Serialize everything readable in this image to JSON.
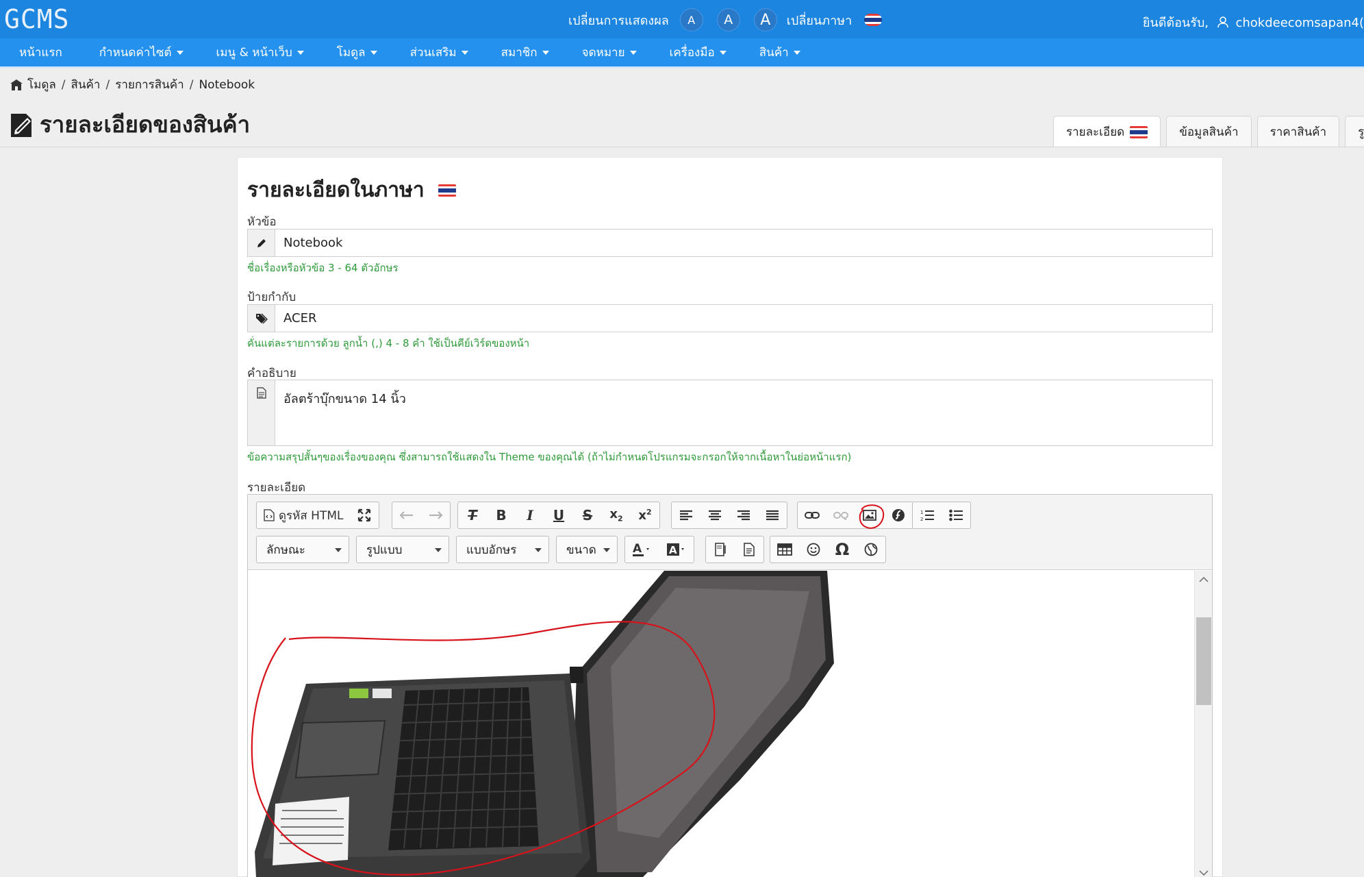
{
  "app": {
    "logo": "GCMS"
  },
  "topbar": {
    "display_label": "เปลี่ยนการแสดงผล",
    "font_sizes": [
      "A",
      "A",
      "A"
    ],
    "language_label": "เปลี่ยนภาษา",
    "welcome": "ยินดีต้อนรับ,",
    "username": "chokdeecomsapan4("
  },
  "nav": {
    "items": [
      {
        "label": "หน้าแรก",
        "dropdown": false
      },
      {
        "label": "กำหนดค่าไซต์",
        "dropdown": true
      },
      {
        "label": "เมนู & หน้าเว็บ",
        "dropdown": true
      },
      {
        "label": "โมดูล",
        "dropdown": true
      },
      {
        "label": "ส่วนเสริม",
        "dropdown": true
      },
      {
        "label": "สมาชิก",
        "dropdown": true
      },
      {
        "label": "จดหมาย",
        "dropdown": true
      },
      {
        "label": "เครื่องมือ",
        "dropdown": true
      },
      {
        "label": "สินค้า",
        "dropdown": true
      }
    ]
  },
  "breadcrumb": [
    "โมดูล",
    "สินค้า",
    "รายการสินค้า",
    "Notebook"
  ],
  "page": {
    "title": "รายละเอียดของสินค้า"
  },
  "tabs": [
    "รายละเอียด",
    "ข้อมูลสินค้า",
    "ราคาสินค้า",
    "รูป"
  ],
  "form": {
    "heading": "รายละเอียดในภาษา",
    "topic": {
      "label": "หัวข้อ",
      "value": "Notebook",
      "hint": "ชื่อเรื่องหรือหัวข้อ 3 - 64 ตัวอักษร"
    },
    "tags": {
      "label": "ป้ายกำกับ",
      "value": "ACER",
      "hint": "คั่นแต่ละรายการด้วย ลูกน้ำ (,) 4 - 8 คำ ใช้เป็นคีย์เวิร์ดของหน้า"
    },
    "description": {
      "label": "คำอธิบาย",
      "value": "อัลตร้าบุ๊กขนาด 14 นิ้ว",
      "hint": "ข้อความสรุปสั้นๆของเรื่องของคุณ ซึ่งสามารถใช้แสดงใน Theme ของคุณได้ (ถ้าไม่กำหนดโปรแกรมจะกรอกให้จากเนื้อหาในย่อหน้าแรก)"
    },
    "detail": {
      "label": "รายละเอียด"
    }
  },
  "editor": {
    "source_label": "ดูรหัส HTML",
    "combos": [
      "ลักษณะ",
      "รูปแบบ",
      "แบบอักษร",
      "ขนาด"
    ],
    "highlighted_button": "image-button"
  },
  "colors": {
    "topbar": "#1b85df",
    "navbar": "#2591ef",
    "hint": "#2e9a3a",
    "annotation": "#d8121a"
  }
}
